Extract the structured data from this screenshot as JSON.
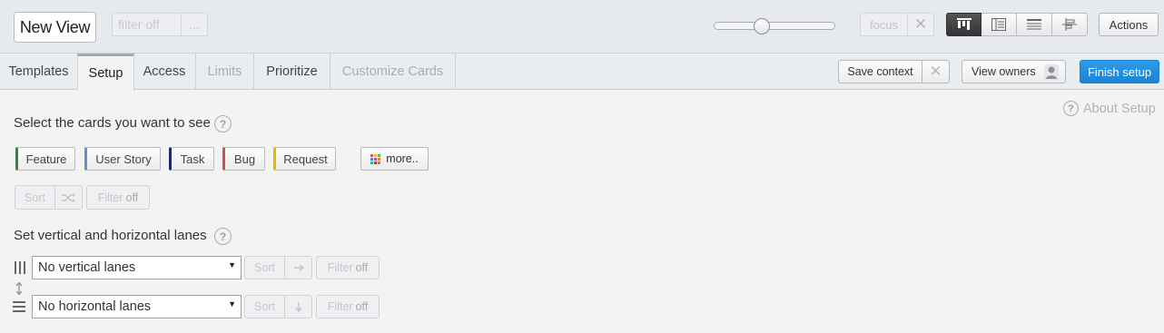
{
  "header": {
    "view_title": "New View",
    "filter_label": "filter off",
    "filter_menu": "...",
    "zoom_level": 0.38,
    "focus_label": "focus",
    "view_modes": [
      "board-view-icon",
      "list-view-icon",
      "table-view-icon",
      "timeline-view-icon"
    ],
    "active_mode": "board-view-icon",
    "actions_label": "Actions"
  },
  "tabs": [
    {
      "label": "Templates",
      "state": "enabled"
    },
    {
      "label": "Setup",
      "state": "active"
    },
    {
      "label": "Access",
      "state": "enabled"
    },
    {
      "label": "Limits",
      "state": "disabled"
    },
    {
      "label": "Prioritize",
      "state": "enabled"
    },
    {
      "label": "Customize Cards",
      "state": "disabled"
    }
  ],
  "toolbar": {
    "save_context": "Save context",
    "view_owners": "View owners",
    "finish_setup": "Finish setup",
    "accent_color": "#1b84d6"
  },
  "setup": {
    "about": "About Setup",
    "cards_heading": "Select the cards you want to see",
    "card_types": [
      {
        "label": "Feature",
        "color": "#2e8b2e"
      },
      {
        "label": "User Story",
        "color": "#6b8ec8"
      },
      {
        "label": "Task",
        "color": "#1f2a6b"
      },
      {
        "label": "Bug",
        "color": "#d05050"
      },
      {
        "label": "Request",
        "color": "#e6b800"
      }
    ],
    "more_label": "more..",
    "sort_label": "Sort",
    "filter_word": "Filter",
    "filter_state": "off",
    "lanes_heading": "Set vertical and horizontal lanes",
    "vertical_lanes": "No vertical lanes",
    "horizontal_lanes": "No horizontal lanes"
  }
}
